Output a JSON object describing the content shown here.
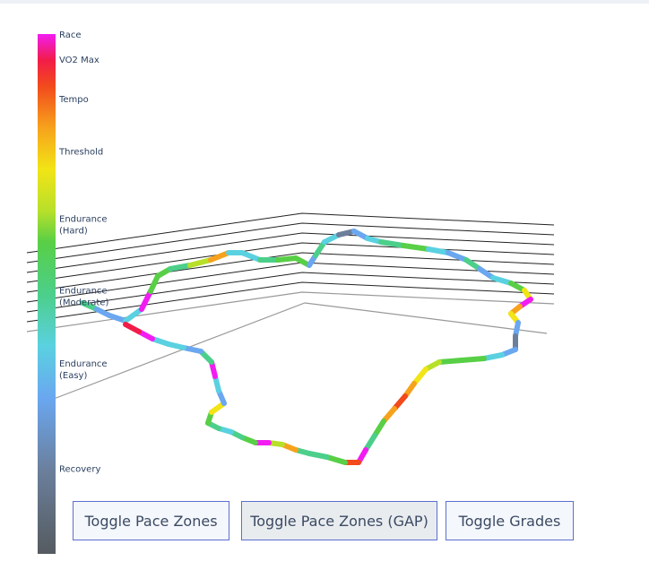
{
  "buttons": [
    {
      "label": "Toggle Pace Zones"
    },
    {
      "label": "Toggle Pace Zones (GAP)"
    },
    {
      "label": "Toggle Grades"
    }
  ],
  "chart_data": {
    "type": "line",
    "mode": "3d-scatter-line",
    "colorbar": {
      "ticks": [
        {
          "label": "Race",
          "value": 1.0
        },
        {
          "label": "VO2 Max",
          "value": 0.952
        },
        {
          "label": "Tempo",
          "value": 0.876
        },
        {
          "label": "Threshold",
          "value": 0.775
        },
        {
          "label": "Endurance\n(Hard)",
          "value": 0.635
        },
        {
          "label": "Endurance\n(Moderate)",
          "value": 0.497
        },
        {
          "label": "Endurance\n(Easy)",
          "value": 0.357
        },
        {
          "label": "Recovery",
          "value": 0.165
        }
      ],
      "colorscale": [
        [
          0.0,
          "#555b60"
        ],
        [
          0.16,
          "#6b7f9c"
        ],
        [
          0.3,
          "#6aa7f0"
        ],
        [
          0.4,
          "#5ad1e0"
        ],
        [
          0.5,
          "#4ccf8a"
        ],
        [
          0.6,
          "#58cf46"
        ],
        [
          0.66,
          "#b8e02a"
        ],
        [
          0.74,
          "#f2e416"
        ],
        [
          0.82,
          "#f7a21c"
        ],
        [
          0.9,
          "#f24a1c"
        ],
        [
          0.95,
          "#f21c48"
        ],
        [
          1.0,
          "#f21cf2"
        ]
      ]
    }
  }
}
